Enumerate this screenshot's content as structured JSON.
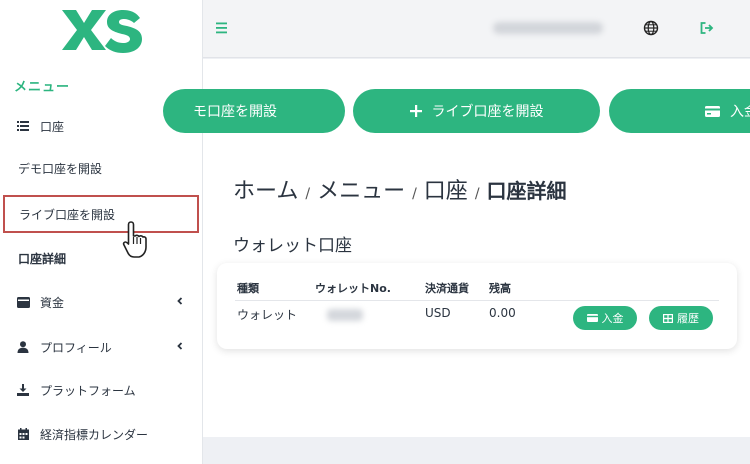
{
  "brand": {
    "logo_text": "XS",
    "color": "#2db580"
  },
  "sidebar": {
    "menu_heading": "メニュー",
    "account": {
      "label": "口座",
      "icon": "list-icon"
    },
    "sub_items": [
      "デモ口座を開設",
      "ライブ口座を開設",
      "口座詳細"
    ],
    "items": [
      {
        "label": "資金",
        "icon": "wallet-icon"
      },
      {
        "label": "プロフィール",
        "icon": "user-icon"
      },
      {
        "label": "プラットフォーム",
        "icon": "download-icon"
      },
      {
        "label": "経済指標カレンダー",
        "icon": "calendar-icon"
      }
    ]
  },
  "header": {
    "menu_icon": "hamburger-icon",
    "globe_icon": "globe-icon",
    "logout_icon": "logout-icon"
  },
  "actions": {
    "demo_label": "モ口座を開設",
    "live_label": "ライブ口座を開設",
    "deposit_label": "入金"
  },
  "breadcrumb": {
    "home": "ホーム",
    "menu": "メニュー",
    "account": "口座",
    "current": "口座詳細",
    "sep": "/"
  },
  "wallet": {
    "title": "ウォレット口座",
    "columns": [
      "種類",
      "ウォレットNo.",
      "決済通貨",
      "残高"
    ],
    "row": {
      "type": "ウォレット",
      "currency": "USD",
      "balance": "0.00"
    },
    "deposit_button": "入金",
    "history_button": "履歴"
  }
}
